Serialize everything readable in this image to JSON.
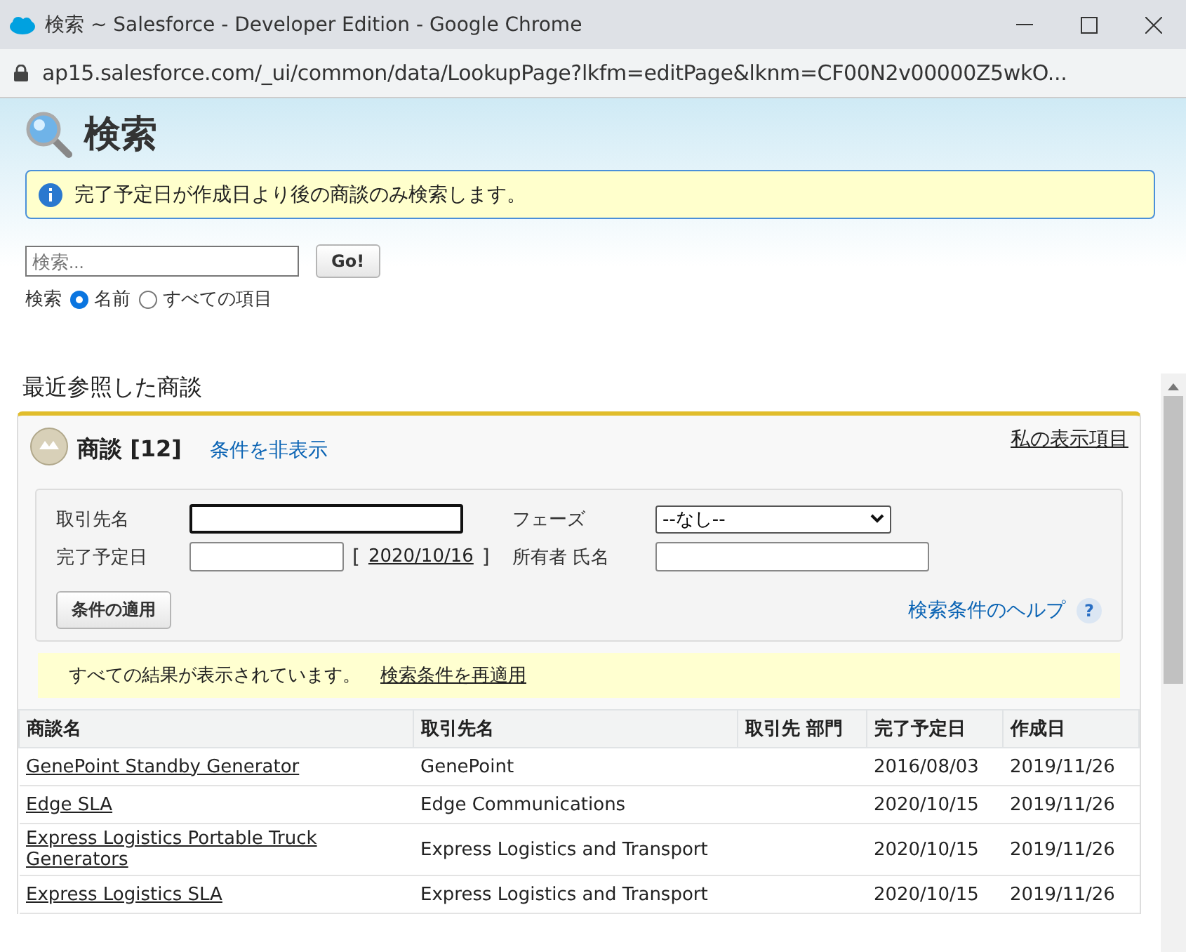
{
  "window": {
    "title": "検索 ~ Salesforce - Developer Edition - Google Chrome",
    "url": "ap15.salesforce.com/_ui/common/data/LookupPage?lkfm=editPage&lknm=CF00N2v00000Z5wkO..."
  },
  "page_title": "検索",
  "info_message": "完了予定日が作成日より後の商談のみ検索します。",
  "search": {
    "placeholder": "検索...",
    "button": "Go!",
    "scope_label": "検索",
    "options": [
      {
        "label": "名前",
        "selected": true
      },
      {
        "label": "すべての項目",
        "selected": false
      }
    ]
  },
  "section_title": "最近参照した商談",
  "list": {
    "title": "商談 [12]",
    "toggle_link": "条件を非表示",
    "my_columns_link": "私の表示項目",
    "filters": {
      "account_label": "取引先名",
      "phase_label": "フェーズ",
      "phase_value": "--なし--",
      "close_date_label": "完了予定日",
      "date_open": "[",
      "date_link": "2020/10/16",
      "date_close": "]",
      "owner_label": "所有者 氏名",
      "apply_button": "条件の適用",
      "help_link": "検索条件のヘルプ",
      "help_icon": "?"
    },
    "notice": "すべての結果が表示されています。",
    "reapply_link": "検索条件を再適用",
    "columns": [
      "商談名",
      "取引先名",
      "取引先 部門",
      "完了予定日",
      "作成日"
    ],
    "rows": [
      {
        "name": "GenePoint Standby Generator",
        "account": "GenePoint",
        "close": "2016/08/03",
        "created": "2019/11/26"
      },
      {
        "name": "Edge SLA",
        "account": "Edge Communications",
        "close": "2020/10/15",
        "created": "2019/11/26"
      },
      {
        "name": "Express Logistics Portable Truck Generators",
        "account": "Express Logistics and Transport",
        "close": "2020/10/15",
        "created": "2019/11/26"
      },
      {
        "name": "Express Logistics SLA",
        "account": "Express Logistics and Transport",
        "close": "2020/10/15",
        "created": "2019/11/26"
      }
    ]
  }
}
